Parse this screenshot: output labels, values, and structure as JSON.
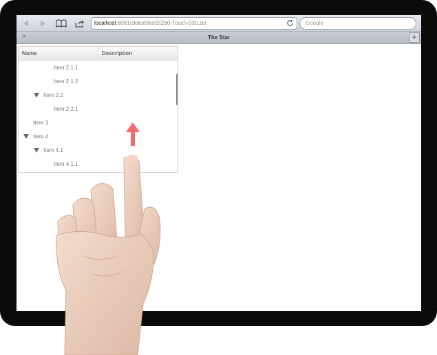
{
  "browser": {
    "url_host": "localhost",
    "url_path": ":8081/zktest/test2/Z60-Touch-030.zul",
    "search_placeholder": "Google",
    "icons": [
      "back-icon",
      "forward-icon",
      "bookmarks-icon",
      "share-icon",
      "reload-icon"
    ]
  },
  "tabbar": {
    "close_label": "×",
    "title": "The Star",
    "add_label": "+"
  },
  "tree": {
    "columns": [
      "Name",
      "Description"
    ],
    "rows": [
      {
        "label": "Item 2.1.1",
        "expanded": false
      },
      {
        "label": "Item 2.1.2",
        "expanded": false
      },
      {
        "label": "Item 2.2",
        "expanded": true
      },
      {
        "label": "Item 2.2.1",
        "expanded": false
      },
      {
        "label": "Item 3",
        "expanded": false
      },
      {
        "label": "Item 4",
        "expanded": true
      },
      {
        "label": "Item 4.1",
        "expanded": true
      },
      {
        "label": "Item 4.1.1",
        "expanded": false
      }
    ]
  },
  "gesture": {
    "direction": "up",
    "arrow_color": "#f36b6b",
    "icons": [
      "swipe-arrow-icon",
      "hand-icon"
    ]
  }
}
